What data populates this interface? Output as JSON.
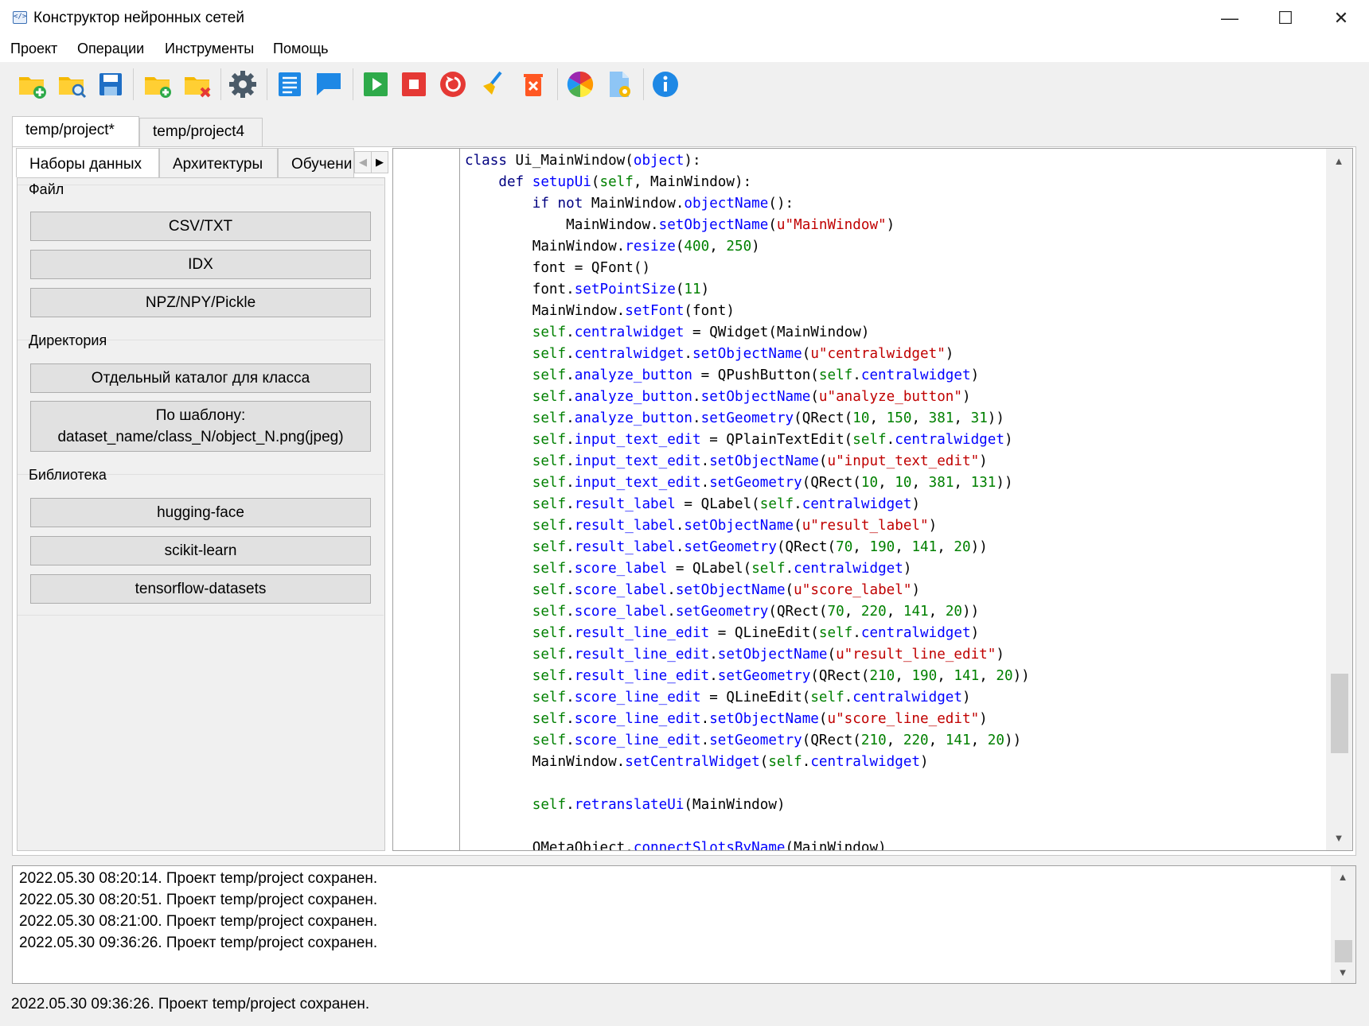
{
  "window": {
    "title": "Конструктор нейронных сетей",
    "minimize": "—",
    "maximize": "☐",
    "close": "✕"
  },
  "menu": [
    "Проект",
    "Операции",
    "Инструменты",
    "Помощь"
  ],
  "toolbar": {
    "icons": [
      "new-project-icon",
      "open-project-icon",
      "save-icon",
      "add-folder-icon",
      "remove-folder-icon",
      "settings-gear-icon",
      "document-list-icon",
      "chat-icon",
      "run-icon",
      "stop-icon",
      "restart-icon",
      "clean-brush-icon",
      "delete-trash-icon",
      "color-wheel-icon",
      "file-settings-icon",
      "info-icon"
    ]
  },
  "project_tabs": [
    "temp/project*",
    "temp/project4"
  ],
  "inner_tabs": [
    "Наборы данных",
    "Архитектуры",
    "Обучени"
  ],
  "groups": {
    "file": {
      "title": "Файл",
      "buttons": [
        "CSV/TXT",
        "IDX",
        "NPZ/NPY/Pickle"
      ]
    },
    "directory": {
      "title": "Директория",
      "buttons": [
        "Отдельный каталог для класса",
        "По шаблону:",
        "dataset_name/class_N/object_N.png(jpeg)"
      ]
    },
    "library": {
      "title": "Библиотека",
      "buttons": [
        "hugging-face",
        "scikit-learn",
        "tensorflow-datasets"
      ]
    }
  },
  "code_lines": [
    "class Ui_MainWindow(object):",
    "    def setupUi(self, MainWindow):",
    "        if not MainWindow.objectName():",
    "            MainWindow.setObjectName(u\"MainWindow\")",
    "        MainWindow.resize(400, 250)",
    "        font = QFont()",
    "        font.setPointSize(11)",
    "        MainWindow.setFont(font)",
    "        self.centralwidget = QWidget(MainWindow)",
    "        self.centralwidget.setObjectName(u\"centralwidget\")",
    "        self.analyze_button = QPushButton(self.centralwidget)",
    "        self.analyze_button.setObjectName(u\"analyze_button\")",
    "        self.analyze_button.setGeometry(QRect(10, 150, 381, 31))",
    "        self.input_text_edit = QPlainTextEdit(self.centralwidget)",
    "        self.input_text_edit.setObjectName(u\"input_text_edit\")",
    "        self.input_text_edit.setGeometry(QRect(10, 10, 381, 131))",
    "        self.result_label = QLabel(self.centralwidget)",
    "        self.result_label.setObjectName(u\"result_label\")",
    "        self.result_label.setGeometry(QRect(70, 190, 141, 20))",
    "        self.score_label = QLabel(self.centralwidget)",
    "        self.score_label.setObjectName(u\"score_label\")",
    "        self.score_label.setGeometry(QRect(70, 220, 141, 20))",
    "        self.result_line_edit = QLineEdit(self.centralwidget)",
    "        self.result_line_edit.setObjectName(u\"result_line_edit\")",
    "        self.result_line_edit.setGeometry(QRect(210, 190, 141, 20))",
    "        self.score_line_edit = QLineEdit(self.centralwidget)",
    "        self.score_line_edit.setObjectName(u\"score_line_edit\")",
    "        self.score_line_edit.setGeometry(QRect(210, 220, 141, 20))",
    "        MainWindow.setCentralWidget(self.centralwidget)",
    "",
    "        self.retranslateUi(MainWindow)",
    "",
    "        QMetaObject.connectSlotsByName(MainWindow)"
  ],
  "log_lines": [
    "2022.05.30 08:20:14. Проект temp/project сохранен.",
    "2022.05.30 08:20:51. Проект temp/project сохранен.",
    "2022.05.30 08:21:00. Проект temp/project сохранен.",
    "2022.05.30 09:36:26. Проект temp/project сохранен."
  ],
  "status": "2022.05.30 09:36:26. Проект temp/project сохранен.",
  "colors": {
    "keyword": "#000080",
    "function": "#0000ff",
    "string": "#c00000",
    "number": "#008000",
    "self": "#008000"
  }
}
